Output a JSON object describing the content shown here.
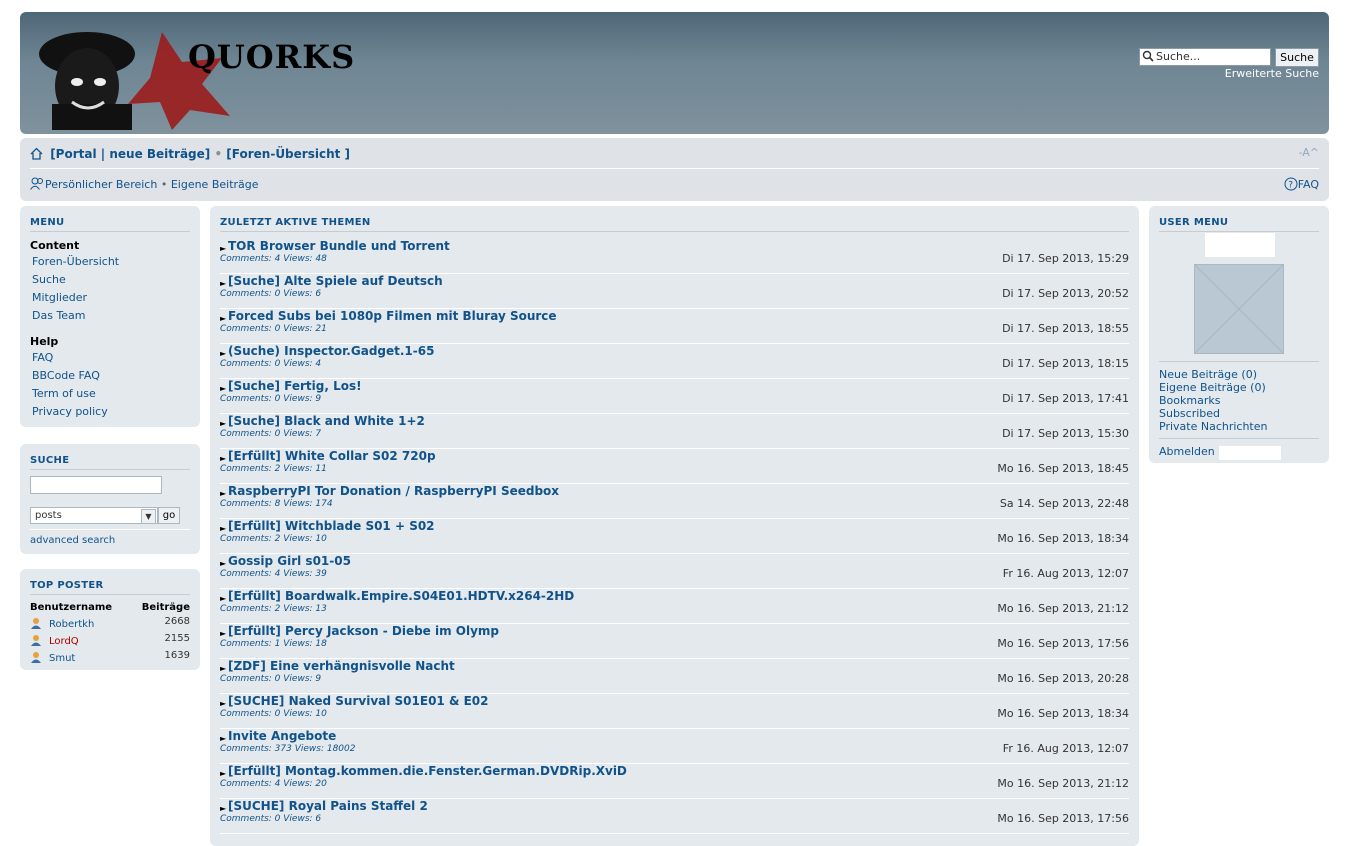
{
  "header": {
    "logo_text": "QUORKS",
    "search_placeholder": "Suche...",
    "search_button": "Suche",
    "advanced_search": "Erweiterte Suche"
  },
  "navbar": {
    "portal": "[Portal",
    "pipe": "|",
    "new_posts": "neue Beiträge]",
    "bullet": "•",
    "forum_index": "[Foren-Übersicht ]",
    "user_cp": "Persönlicher Bereich",
    "own_posts": "Eigene Beiträge",
    "faq": "FAQ",
    "font_size": "-A^"
  },
  "menu": {
    "title": "MENU",
    "content_heading": "Content",
    "content_items": [
      "Foren-Übersicht",
      "Suche",
      "Mitglieder",
      "Das Team"
    ],
    "help_heading": "Help",
    "help_items": [
      "FAQ",
      "BBCode FAQ",
      "Term of use",
      "Privacy policy"
    ]
  },
  "search_panel": {
    "title": "SUCHE",
    "select_value": "posts",
    "go_label": "go",
    "advanced": "advanced search"
  },
  "top_poster": {
    "title": "TOP POSTER",
    "col_user": "Benutzername",
    "col_posts": "Beiträge",
    "rows": [
      {
        "name": "Robertkh",
        "count": "2668",
        "color": "#105289"
      },
      {
        "name": "LordQ",
        "count": "2155",
        "color": "#aa0000"
      },
      {
        "name": "Smut",
        "count": "1639",
        "color": "#105289"
      }
    ]
  },
  "recent_topics": {
    "title": "ZULETZT AKTIVE THEMEN",
    "topics": [
      {
        "title": "TOR Browser Bundle und Torrent",
        "meta": "Comments: 4 Views: 48",
        "date": "Di 17. Sep 2013, 15:29"
      },
      {
        "title": "[Suche] Alte Spiele auf Deutsch",
        "meta": "Comments: 0 Views: 6",
        "date": "Di 17. Sep 2013, 20:52"
      },
      {
        "title": "Forced Subs bei 1080p Filmen mit Bluray Source",
        "meta": "Comments: 0 Views: 21",
        "date": "Di 17. Sep 2013, 18:55"
      },
      {
        "title": "(Suche) Inspector.Gadget.1-65",
        "meta": "Comments: 0 Views: 4",
        "date": "Di 17. Sep 2013, 18:15"
      },
      {
        "title": "[Suche] Fertig, Los!",
        "meta": "Comments: 0 Views: 9",
        "date": "Di 17. Sep 2013, 17:41"
      },
      {
        "title": "[Suche] Black and White 1+2",
        "meta": "Comments: 0 Views: 7",
        "date": "Di 17. Sep 2013, 15:30"
      },
      {
        "title": "[Erfüllt] White Collar S02 720p",
        "meta": "Comments: 2 Views: 11",
        "date": "Mo 16. Sep 2013, 18:45"
      },
      {
        "title": "RaspberryPI Tor Donation / RaspberryPI Seedbox",
        "meta": "Comments: 8 Views: 174",
        "date": "Sa 14. Sep 2013, 22:48"
      },
      {
        "title": "[Erfüllt] Witchblade S01 + S02",
        "meta": "Comments: 2 Views: 10",
        "date": "Mo 16. Sep 2013, 18:34"
      },
      {
        "title": "Gossip Girl s01-05",
        "meta": "Comments: 4 Views: 39",
        "date": "Fr 16. Aug 2013, 12:07"
      },
      {
        "title": "[Erfüllt] Boardwalk.Empire.S04E01.HDTV.x264-2HD",
        "meta": "Comments: 2 Views: 13",
        "date": "Mo 16. Sep 2013, 21:12"
      },
      {
        "title": "[Erfüllt] Percy Jackson - Diebe im Olymp",
        "meta": "Comments: 1 Views: 18",
        "date": "Mo 16. Sep 2013, 17:56"
      },
      {
        "title": "[ZDF] Eine verhängnisvolle Nacht",
        "meta": "Comments: 0 Views: 9",
        "date": "Mo 16. Sep 2013, 20:28"
      },
      {
        "title": "[SUCHE] Naked Survival S01E01 & E02",
        "meta": "Comments: 0 Views: 10",
        "date": "Mo 16. Sep 2013, 18:34"
      },
      {
        "title": "Invite Angebote",
        "meta": "Comments: 373 Views: 18002",
        "date": "Fr 16. Aug 2013, 12:07"
      },
      {
        "title": "[Erfüllt] Montag.kommen.die.Fenster.German.DVDRip.XviD",
        "meta": "Comments: 4 Views: 20",
        "date": "Mo 16. Sep 2013, 21:12"
      },
      {
        "title": "[SUCHE] Royal Pains Staffel 2",
        "meta": "Comments: 0 Views: 6",
        "date": "Mo 16. Sep 2013, 17:56"
      }
    ]
  },
  "user_menu": {
    "title": "USER MENU",
    "links": [
      "Neue Beiträge (0)",
      "Eigene Beiträge (0)",
      "Bookmarks",
      "Subscribed",
      "Private Nachrichten"
    ],
    "logout": "Abmelden"
  }
}
